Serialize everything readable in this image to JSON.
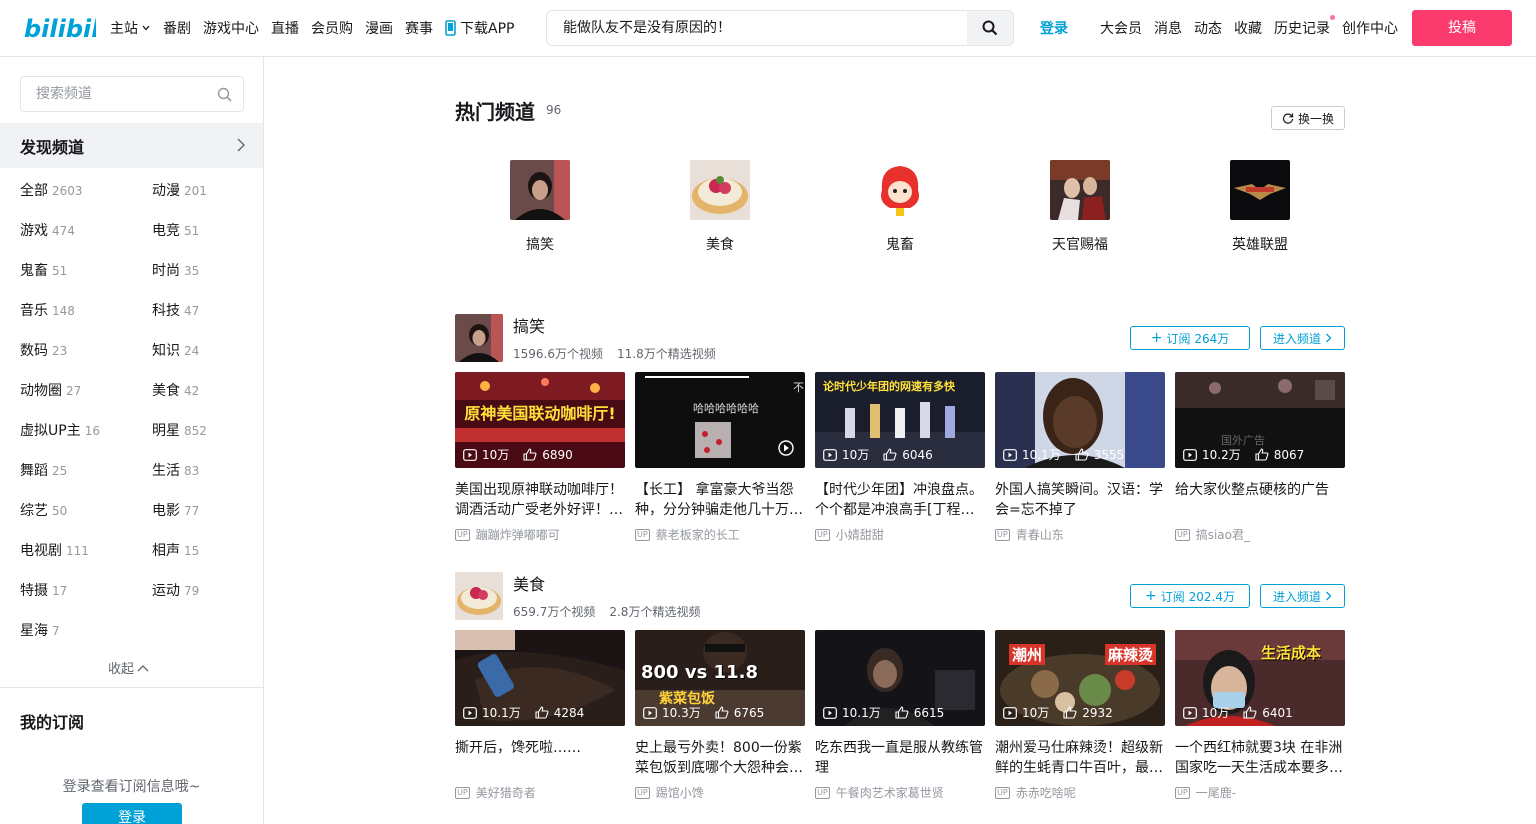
{
  "header": {
    "nav": [
      "主站",
      "番剧",
      "游戏中心",
      "直播",
      "会员购",
      "漫画",
      "赛事"
    ],
    "download_app": "下载APP",
    "search_value": "能做队友不是没有原因的！",
    "login": "登录",
    "right_nav": [
      "大会员",
      "消息",
      "动态",
      "收藏",
      "历史记录",
      "创作中心"
    ],
    "upload": "投稿"
  },
  "sidebar": {
    "search_placeholder": "搜索频道",
    "discover": "发现频道",
    "categories": [
      {
        "name": "全部",
        "count": "2603"
      },
      {
        "name": "动漫",
        "count": "201"
      },
      {
        "name": "游戏",
        "count": "474"
      },
      {
        "name": "电竞",
        "count": "51"
      },
      {
        "name": "鬼畜",
        "count": "51"
      },
      {
        "name": "时尚",
        "count": "35"
      },
      {
        "name": "音乐",
        "count": "148"
      },
      {
        "name": "科技",
        "count": "47"
      },
      {
        "name": "数码",
        "count": "23"
      },
      {
        "name": "知识",
        "count": "24"
      },
      {
        "name": "动物圈",
        "count": "27"
      },
      {
        "name": "美食",
        "count": "42"
      },
      {
        "name": "虚拟UP主",
        "count": "16"
      },
      {
        "name": "明星",
        "count": "852"
      },
      {
        "name": "舞蹈",
        "count": "25"
      },
      {
        "name": "生活",
        "count": "83"
      },
      {
        "name": "综艺",
        "count": "50"
      },
      {
        "name": "电影",
        "count": "77"
      },
      {
        "name": "电视剧",
        "count": "111"
      },
      {
        "name": "相声",
        "count": "15"
      },
      {
        "name": "特摄",
        "count": "17"
      },
      {
        "name": "运动",
        "count": "79"
      },
      {
        "name": "星海",
        "count": "7"
      }
    ],
    "collapse": "收起",
    "my_sub": "我的订阅",
    "sub_tip": "登录查看订阅信息哦~",
    "login": "登录"
  },
  "hot": {
    "title": "热门频道",
    "count": "96",
    "refresh": "换一换",
    "channels": [
      "搞笑",
      "美食",
      "鬼畜",
      "天官赐福",
      "英雄联盟"
    ]
  },
  "sections": [
    {
      "name": "搞笑",
      "videos_count": "1596.6万个视频",
      "featured_count": "11.8万个精选视频",
      "subscribe": "订阅 264万",
      "enter": "进入频道",
      "videos": [
        {
          "title": "美国出现原神联动咖啡厅！调酒活动广受老外好评！…",
          "plays": "10万",
          "likes": "6890",
          "up": "蹦蹦炸弹嘟嘟可"
        },
        {
          "title": "【长工】 拿富豪大爷当怨种，分分钟骗走他几十万…",
          "plays": "",
          "likes": "",
          "up": "蔡老板家的长工"
        },
        {
          "title": "【时代少年团】冲浪盘点。个个都是冲浪高手[丁程…",
          "plays": "10万",
          "likes": "6046",
          "up": "小婧甜甜"
        },
        {
          "title": "外国人搞笑瞬间。汉语：学会=忘不掉了",
          "plays": "10.1万",
          "likes": "3555",
          "up": "青春山东"
        },
        {
          "title": "给大家伙整点硬核的广告",
          "plays": "10.2万",
          "likes": "8067",
          "up": "搞siao君_"
        }
      ]
    },
    {
      "name": "美食",
      "videos_count": "659.7万个视频",
      "featured_count": "2.8万个精选视频",
      "subscribe": "订阅 202.4万",
      "enter": "进入频道",
      "videos": [
        {
          "title": "撕开后，馋死啦……",
          "plays": "10.1万",
          "likes": "4284",
          "up": "美好猎奇者"
        },
        {
          "title": "史上最亏外卖！800一份紫菜包饭到底哪个大怨种会…",
          "plays": "10.3万",
          "likes": "6765",
          "up": "踢馆小馋"
        },
        {
          "title": "吃东西我一直是服从教练管理",
          "plays": "10.1万",
          "likes": "6615",
          "up": "午餐肉艺术家葛世贤"
        },
        {
          "title": "潮州爱马仕麻辣烫！超级新鲜的生蚝青口牛百叶，最…",
          "plays": "10万",
          "likes": "2932",
          "up": "赤赤吃啥呢"
        },
        {
          "title": "一个西红柿就要3块 在非洲国家吃一天生活成本要多…",
          "plays": "10万",
          "likes": "6401",
          "up": "一尾鹿-"
        }
      ]
    }
  ],
  "thumb_texts": {
    "s0v0": "原神美国联动咖啡厅!",
    "s0v1a": "哈哈哈哈哈哈",
    "s0v1b": "不",
    "s0v2": "论时代少年团的网速有多快",
    "s0v4": "国外广告",
    "s1v1": "800 vs 11.8",
    "s1v1b": "紫菜包饭",
    "s1v3a": "潮州",
    "s1v3b": "麻辣烫",
    "s1v4": "生活成本"
  },
  "colors": {
    "accent": "#00a1d6",
    "upload": "#fb3a6e",
    "pink": "#fb7299"
  }
}
